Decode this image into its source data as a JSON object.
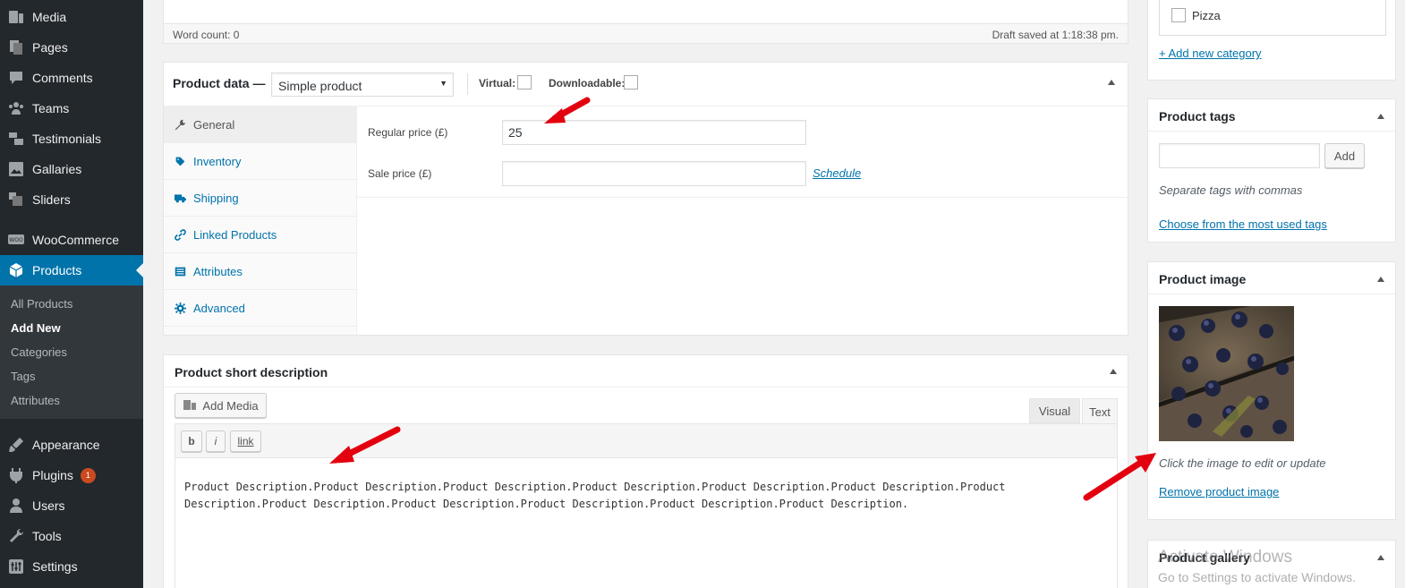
{
  "sidebar": {
    "items": [
      {
        "label": "Media",
        "icon": "media-icon"
      },
      {
        "label": "Pages",
        "icon": "pages-icon"
      },
      {
        "label": "Comments",
        "icon": "comments-icon"
      },
      {
        "label": "Teams",
        "icon": "teams-icon"
      },
      {
        "label": "Testimonials",
        "icon": "testimonials-icon"
      },
      {
        "label": "Gallaries",
        "icon": "gallaries-icon"
      },
      {
        "label": "Sliders",
        "icon": "sliders-icon"
      },
      {
        "label": "WooCommerce",
        "icon": "woocommerce-icon"
      },
      {
        "label": "Products",
        "icon": "products-icon"
      },
      {
        "label": "Appearance",
        "icon": "appearance-icon"
      },
      {
        "label": "Plugins",
        "icon": "plugins-icon",
        "badge": "1"
      },
      {
        "label": "Users",
        "icon": "users-icon"
      },
      {
        "label": "Tools",
        "icon": "tools-icon"
      },
      {
        "label": "Settings",
        "icon": "settings-icon"
      }
    ],
    "submenu": [
      "All Products",
      "Add New",
      "Categories",
      "Tags",
      "Attributes"
    ]
  },
  "editor_status": {
    "word_count": "Word count: 0",
    "draft_saved": "Draft saved at 1:18:38 pm."
  },
  "product_data": {
    "title": "Product data —",
    "type_selected": "Simple product",
    "virtual_label": "Virtual:",
    "downloadable_label": "Downloadable:",
    "tabs": [
      "General",
      "Inventory",
      "Shipping",
      "Linked Products",
      "Attributes",
      "Advanced"
    ],
    "regular_price_label": "Regular price (£)",
    "regular_price_value": "25",
    "sale_price_label": "Sale price (£)",
    "sale_price_value": "",
    "schedule_link": "Schedule"
  },
  "short_description": {
    "title": "Product short description",
    "add_media": "Add Media",
    "tab_visual": "Visual",
    "tab_text": "Text",
    "qt_bold": "b",
    "qt_italic": "i",
    "qt_link": "link",
    "content": "Product Description.Product Description.Product Description.Product Description.Product Description.Product Description.Product Description.Product Description.Product Description.Product Description.Product Description.Product Description."
  },
  "categories": {
    "item": "Pizza",
    "add_new": "+ Add new category"
  },
  "product_tags": {
    "title": "Product tags",
    "input_value": "",
    "add_button": "Add",
    "hint": "Separate tags with commas",
    "most_used": "Choose from the most used tags"
  },
  "product_image": {
    "title": "Product image",
    "hint": "Click the image to edit or update",
    "remove_link": "Remove product image"
  },
  "product_gallery": {
    "title": "Product gallery"
  },
  "watermark": {
    "line1": "Activate Windows",
    "line2": "Go to Settings to activate Windows."
  },
  "colors": {
    "sidebar_bg": "#23282d",
    "accent": "#0073aa",
    "annotation_arrow": "#e3000f"
  }
}
